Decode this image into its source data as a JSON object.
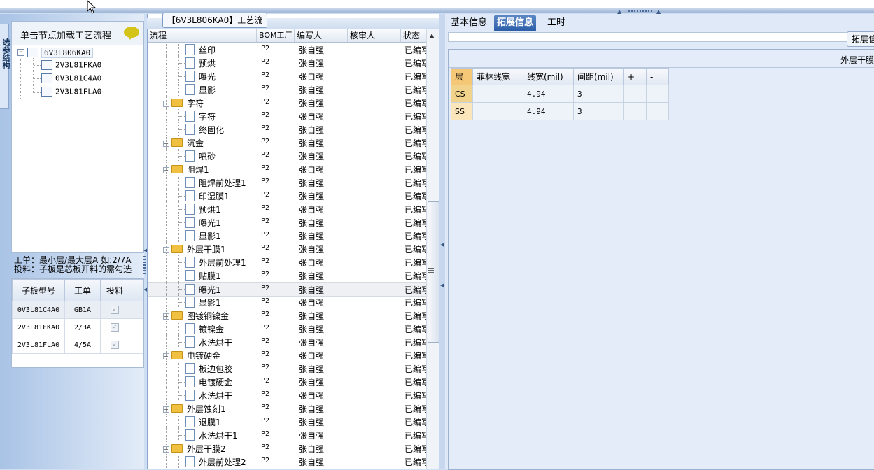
{
  "left": {
    "side_tab": "选参结构",
    "tree_header": "单击节点加载工艺流程",
    "tree": {
      "root": "6V3L806KA0",
      "children": [
        "2V3L81FKA0",
        "0V3L81C4A0",
        "2V3L81FLA0"
      ]
    },
    "info_line1": "工单：最小层/最大层A 如:2/7A",
    "info_line2": "投料：子板是芯板开料的需勾选",
    "sub_table": {
      "headers": [
        "子板型号",
        "工单",
        "投料"
      ],
      "rows": [
        {
          "model": "0V3L81C4A0",
          "order": "GB1A",
          "checked": true
        },
        {
          "model": "2V3L81FKA0",
          "order": "2/3A",
          "checked": true
        },
        {
          "model": "2V3L81FLA0",
          "order": "4/5A",
          "checked": true
        }
      ]
    }
  },
  "middle": {
    "title": "【6V3L806KA0】工艺流程",
    "headers": {
      "flow": "流程",
      "bom": "BOM工厂",
      "writer": "编写人",
      "reviewer": "核审人",
      "status": "状态"
    },
    "rows": [
      {
        "name": "丝印",
        "level": 2,
        "folder": false,
        "bom": "P2",
        "writer": "张自强",
        "status": "已编写"
      },
      {
        "name": "预烘",
        "level": 2,
        "folder": false,
        "bom": "P2",
        "writer": "张自强",
        "status": "已编写"
      },
      {
        "name": "曝光",
        "level": 2,
        "folder": false,
        "bom": "P2",
        "writer": "张自强",
        "status": "已编写"
      },
      {
        "name": "显影",
        "level": 2,
        "folder": false,
        "bom": "P2",
        "writer": "张自强",
        "status": "已编写"
      },
      {
        "name": "字符",
        "level": 1,
        "folder": true,
        "bom": "P2",
        "writer": "张自强",
        "status": "已编写"
      },
      {
        "name": "字符",
        "level": 2,
        "folder": false,
        "bom": "P2",
        "writer": "张自强",
        "status": "已编写"
      },
      {
        "name": "终固化",
        "level": 2,
        "folder": false,
        "bom": "P2",
        "writer": "张自强",
        "status": "已编写"
      },
      {
        "name": "沉金",
        "level": 1,
        "folder": true,
        "bom": "P2",
        "writer": "张自强",
        "status": "已编写"
      },
      {
        "name": "喷砂",
        "level": 2,
        "folder": false,
        "bom": "P2",
        "writer": "张自强",
        "status": "已编写"
      },
      {
        "name": "阻焊1",
        "level": 1,
        "folder": true,
        "bom": "P2",
        "writer": "张自强",
        "status": "已编写"
      },
      {
        "name": "阻焊前处理1",
        "level": 2,
        "folder": false,
        "bom": "P2",
        "writer": "张自强",
        "status": "已编写"
      },
      {
        "name": "印湿膜1",
        "level": 2,
        "folder": false,
        "bom": "P2",
        "writer": "张自强",
        "status": "已编写"
      },
      {
        "name": "预烘1",
        "level": 2,
        "folder": false,
        "bom": "P2",
        "writer": "张自强",
        "status": "已编写"
      },
      {
        "name": "曝光1",
        "level": 2,
        "folder": false,
        "bom": "P2",
        "writer": "张自强",
        "status": "已编写"
      },
      {
        "name": "显影1",
        "level": 2,
        "folder": false,
        "bom": "P2",
        "writer": "张自强",
        "status": "已编写"
      },
      {
        "name": "外层干膜1",
        "level": 1,
        "folder": true,
        "bom": "P2",
        "writer": "张自强",
        "status": "已编写"
      },
      {
        "name": "外层前处理1",
        "level": 2,
        "folder": false,
        "bom": "P2",
        "writer": "张自强",
        "status": "已编写"
      },
      {
        "name": "贴膜1",
        "level": 2,
        "folder": false,
        "bom": "P2",
        "writer": "张自强",
        "status": "已编写"
      },
      {
        "name": "曝光1",
        "level": 2,
        "folder": false,
        "bom": "P2",
        "writer": "张自强",
        "status": "已编写",
        "selected": true
      },
      {
        "name": "显影1",
        "level": 2,
        "folder": false,
        "bom": "P2",
        "writer": "张自强",
        "status": "已编写"
      },
      {
        "name": "图镀铜镍金",
        "level": 1,
        "folder": true,
        "bom": "P2",
        "writer": "张自强",
        "status": "已编写"
      },
      {
        "name": "镀镍金",
        "level": 2,
        "folder": false,
        "bom": "P2",
        "writer": "张自强",
        "status": "已编写"
      },
      {
        "name": "水洗烘干",
        "level": 2,
        "folder": false,
        "bom": "P2",
        "writer": "张自强",
        "status": "已编写"
      },
      {
        "name": "电镀硬金",
        "level": 1,
        "folder": true,
        "bom": "P2",
        "writer": "张自强",
        "status": "已编写"
      },
      {
        "name": "板边包胶",
        "level": 2,
        "folder": false,
        "bom": "P2",
        "writer": "张自强",
        "status": "已编写"
      },
      {
        "name": "电镀硬金",
        "level": 2,
        "folder": false,
        "bom": "P2",
        "writer": "张自强",
        "status": "已编写"
      },
      {
        "name": "水洗烘干",
        "level": 2,
        "folder": false,
        "bom": "P2",
        "writer": "张自强",
        "status": "已编写"
      },
      {
        "name": "外层蚀刻1",
        "level": 1,
        "folder": true,
        "bom": "P2",
        "writer": "张自强",
        "status": "已编写"
      },
      {
        "name": "退膜1",
        "level": 2,
        "folder": false,
        "bom": "P2",
        "writer": "张自强",
        "status": "已编写"
      },
      {
        "name": "水洗烘干1",
        "level": 2,
        "folder": false,
        "bom": "P2",
        "writer": "张自强",
        "status": "已编写"
      },
      {
        "name": "外层干膜2",
        "level": 1,
        "folder": true,
        "bom": "P2",
        "writer": "张自强",
        "status": "已编写"
      },
      {
        "name": "外层前处理2",
        "level": 2,
        "folder": false,
        "bom": "P2",
        "writer": "张自强",
        "status": "已编写"
      }
    ]
  },
  "right": {
    "tabs": [
      {
        "label": "基本信息",
        "active": false
      },
      {
        "label": "拓展信息",
        "active": true
      },
      {
        "label": "工时",
        "active": false
      }
    ],
    "tuozhan_button": "拓展信",
    "panel_title": "外层干膜",
    "ext_headers": [
      "层",
      "菲林线宽",
      "线宽(mil)",
      "间距(mil)",
      "+",
      "-"
    ],
    "ext_rows": [
      {
        "layer": "CS",
        "film": "",
        "width": "4.94",
        "spacing": "3"
      },
      {
        "layer": "SS",
        "film": "",
        "width": "4.94",
        "spacing": "3"
      }
    ]
  },
  "colors": {
    "tab_active": "#2c5ea8",
    "folder": "#f0c040",
    "layer_header": "#f5c877"
  }
}
